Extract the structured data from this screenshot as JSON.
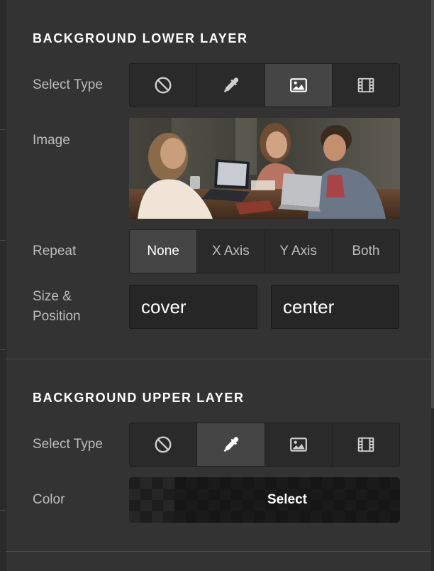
{
  "lower_layer": {
    "title": "BACKGROUND LOWER LAYER",
    "select_type_label": "Select Type",
    "type_options": [
      {
        "icon": "none-icon",
        "active": false
      },
      {
        "icon": "eyedropper-icon",
        "active": false
      },
      {
        "icon": "image-icon",
        "active": true
      },
      {
        "icon": "video-icon",
        "active": false
      }
    ],
    "image_label": "Image",
    "repeat_label": "Repeat",
    "repeat_options": [
      "None",
      "X Axis",
      "Y Axis",
      "Both"
    ],
    "repeat_selected": "None",
    "size_position_label_line1": "Size &",
    "size_position_label_line2": "Position",
    "size_value": "cover",
    "position_value": "center"
  },
  "upper_layer": {
    "title": "BACKGROUND UPPER LAYER",
    "select_type_label": "Select Type",
    "type_options": [
      {
        "icon": "none-icon",
        "active": false
      },
      {
        "icon": "eyedropper-icon",
        "active": true
      },
      {
        "icon": "image-icon",
        "active": false
      },
      {
        "icon": "video-icon",
        "active": false
      }
    ],
    "color_label": "Color",
    "color_button": "Select"
  },
  "colors": {
    "panel_bg": "#333333",
    "active_option": "#454545",
    "field_bg": "#262626",
    "title_text": "#ffffff",
    "label_text": "#bdbdbd"
  }
}
